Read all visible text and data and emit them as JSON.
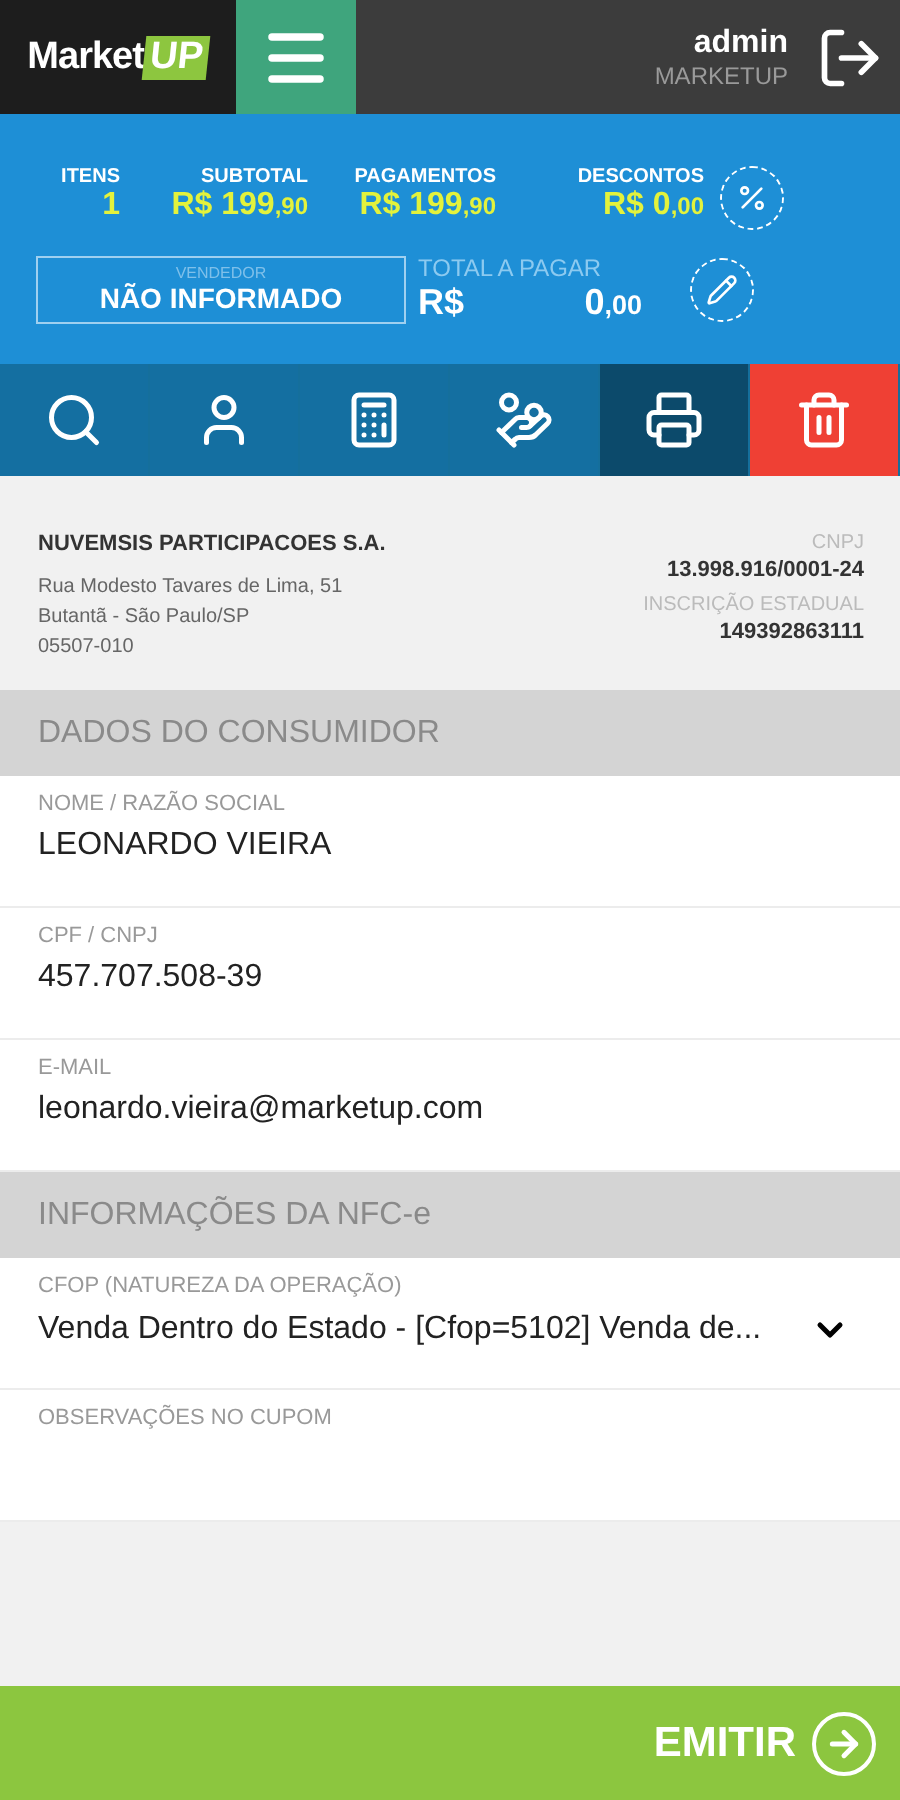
{
  "header": {
    "logo": {
      "word": "Market",
      "badge": "UP"
    },
    "user": "admin",
    "company": "MARKETUP"
  },
  "summary": {
    "stats": [
      {
        "label": "ITENS",
        "amount": "1"
      },
      {
        "label": "SUBTOTAL",
        "currency": "R$",
        "amount": "199",
        "cents": ",90"
      },
      {
        "label": "PAGAMENTOS",
        "currency": "R$",
        "amount": "199",
        "cents": ",90"
      },
      {
        "label": "DESCONTOS",
        "currency": "R$",
        "amount": "0",
        "cents": ",00"
      }
    ],
    "seller": {
      "label": "VENDEDOR",
      "value": "NÃO INFORMADO"
    },
    "total": {
      "label": "TOTAL A PAGAR",
      "currency": "R$",
      "amount": "0",
      "cents": ",00"
    }
  },
  "toolbar": [
    {
      "kind": "search",
      "selected": false
    },
    {
      "kind": "customer",
      "selected": false
    },
    {
      "kind": "register",
      "selected": false
    },
    {
      "kind": "payment",
      "selected": false
    },
    {
      "kind": "receipt",
      "selected": true
    },
    {
      "kind": "delete",
      "selected": false
    }
  ],
  "company": {
    "name": "NUVEMSIS PARTICIPACOES S.A.",
    "address": [
      "Rua Modesto Tavares de Lima, 51",
      "Butantã - São Paulo/SP",
      "05507-010"
    ],
    "ids": [
      {
        "label": "CNPJ",
        "value": "13.998.916/0001-24"
      },
      {
        "label": "INSCRIÇÃO ESTADUAL",
        "value": "149392863111"
      }
    ]
  },
  "sections": [
    {
      "title": "DADOS DO CONSUMIDOR",
      "fields": [
        {
          "kind": "text",
          "label": "NOME / RAZÃO SOCIAL",
          "value": "LEONARDO VIEIRA"
        },
        {
          "kind": "text",
          "label": "CPF / CNPJ",
          "value": "457.707.508-39"
        },
        {
          "kind": "text",
          "label": "E-MAIL",
          "value": "leonardo.vieira@marketup.com"
        }
      ]
    },
    {
      "title": "INFORMAÇÕES DA NFC-e",
      "fields": [
        {
          "kind": "select",
          "label": "CFOP (NATUREZA DA OPERAÇÃO)",
          "value": "Venda Dentro do Estado - [Cfop=5102] Venda de..."
        },
        {
          "kind": "text",
          "label": "OBSERVAÇÕES NO CUPOM"
        }
      ]
    }
  ],
  "footer": {
    "button": "EMITIR"
  }
}
